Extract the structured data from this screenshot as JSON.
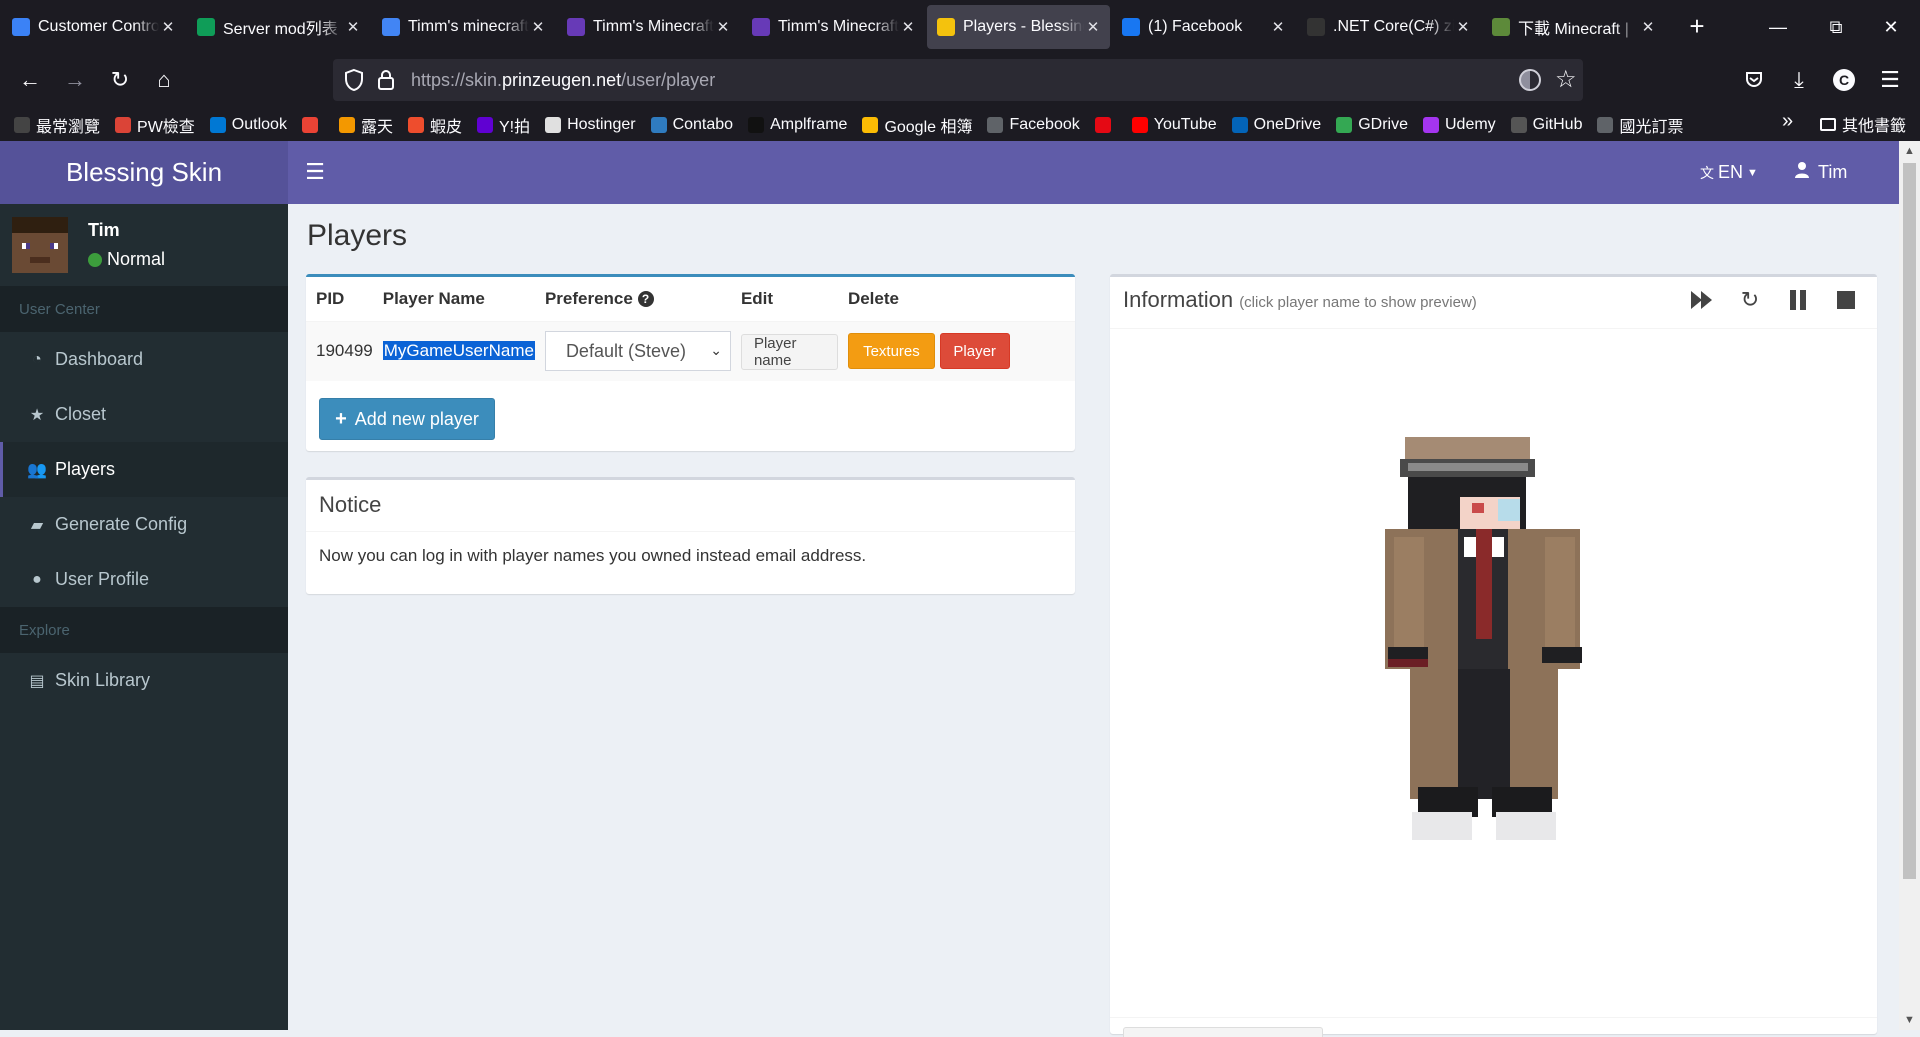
{
  "browser": {
    "tabs": [
      {
        "title": "Customer Control",
        "icon": "cloud-icon",
        "color": "#3b82f6"
      },
      {
        "title": "Server mod列表",
        "icon": "sheets-icon",
        "color": "#0f9d58"
      },
      {
        "title": "Timm's minecraft",
        "icon": "docs-icon",
        "color": "#4285f4"
      },
      {
        "title": "Timm's Minecraft",
        "icon": "forms-icon",
        "color": "#673ab7"
      },
      {
        "title": "Timm's Minecraft",
        "icon": "forms-icon",
        "color": "#673ab7"
      },
      {
        "title": "Players - Blessing",
        "icon": "crown-icon",
        "color": "#f4c20d"
      },
      {
        "title": "(1) Facebook",
        "icon": "facebook-icon",
        "color": "#1877f2"
      },
      {
        "title": ".NET Core(C#) zi",
        "icon": "dotnet-icon",
        "color": "#333333"
      },
      {
        "title": "下載 Minecraft |",
        "icon": "minecraft-icon",
        "color": "#5d8a3a"
      }
    ],
    "url_prefix": "https://skin.",
    "url_domain": "prinzeugen.net",
    "url_path": "/user/player",
    "bookmarks": [
      {
        "label": "最常瀏覽",
        "icon": "gear-icon",
        "color": "#444444"
      },
      {
        "label": "PW檢查",
        "icon": "google-icon",
        "color": "#db4437"
      },
      {
        "label": "Outlook",
        "icon": "outlook-icon",
        "color": "#0078d4"
      },
      {
        "label": "",
        "icon": "gmail-icon",
        "color": "#ea4335"
      },
      {
        "label": "露天",
        "icon": "ruten-icon",
        "color": "#f39800"
      },
      {
        "label": "蝦皮",
        "icon": "shopee-icon",
        "color": "#ee4d2d"
      },
      {
        "label": "Y!拍",
        "icon": "yahoo-icon",
        "color": "#6001d2"
      },
      {
        "label": "Hostinger",
        "icon": "hostinger-icon",
        "color": "#e0e0e0"
      },
      {
        "label": "Contabo",
        "icon": "cloud-icon",
        "color": "#2f7bbf"
      },
      {
        "label": "Amplframe",
        "icon": "amplframe-icon",
        "color": "#111111"
      },
      {
        "label": "Google 相簿",
        "icon": "photos-icon",
        "color": "#fbbc04"
      },
      {
        "label": "Facebook",
        "icon": "globe-icon",
        "color": "#5f6368"
      },
      {
        "label": "",
        "icon": "netflix-icon",
        "color": "#e50914"
      },
      {
        "label": "YouTube",
        "icon": "youtube-icon",
        "color": "#ff0000"
      },
      {
        "label": "OneDrive",
        "icon": "onedrive-icon",
        "color": "#0364b8"
      },
      {
        "label": "GDrive",
        "icon": "gdrive-icon",
        "color": "#34a853"
      },
      {
        "label": "Udemy",
        "icon": "udemy-icon",
        "color": "#a435f0"
      },
      {
        "label": "GitHub",
        "icon": "github-icon",
        "color": "#555555"
      },
      {
        "label": "國光訂票",
        "icon": "globe-icon",
        "color": "#5f6368"
      }
    ],
    "other_bookmarks": "其他書籤"
  },
  "app": {
    "brand": "Blessing Skin",
    "lang": "EN",
    "user_menu": "Tim",
    "sidebar": {
      "user_name": "Tim",
      "user_status": "Normal",
      "sections": [
        {
          "header": "User Center",
          "items": [
            {
              "label": "Dashboard",
              "icon": "dashboard-icon"
            },
            {
              "label": "Closet",
              "icon": "star-icon"
            },
            {
              "label": "Players",
              "icon": "users-icon",
              "active": true
            },
            {
              "label": "Generate Config",
              "icon": "book-icon"
            },
            {
              "label": "User Profile",
              "icon": "user-icon"
            }
          ]
        },
        {
          "header": "Explore",
          "items": [
            {
              "label": "Skin Library",
              "icon": "list-icon"
            }
          ]
        }
      ]
    },
    "main": {
      "title": "Players",
      "players_table": {
        "headers": [
          "PID",
          "Player Name",
          "Preference",
          "Edit",
          "Delete"
        ],
        "rows": [
          {
            "pid": "190499",
            "player_name": "MyGameUserName",
            "preference": "Default (Steve)",
            "edit_label": "Player name",
            "delete_textures_label": "Textures",
            "delete_player_label": "Player"
          }
        ],
        "add_button": "Add new player"
      },
      "notice": {
        "title": "Notice",
        "body": "Now you can log in with player names you owned instead email address."
      },
      "info": {
        "title": "Information",
        "subtitle": "(click player name to show preview)"
      }
    }
  }
}
